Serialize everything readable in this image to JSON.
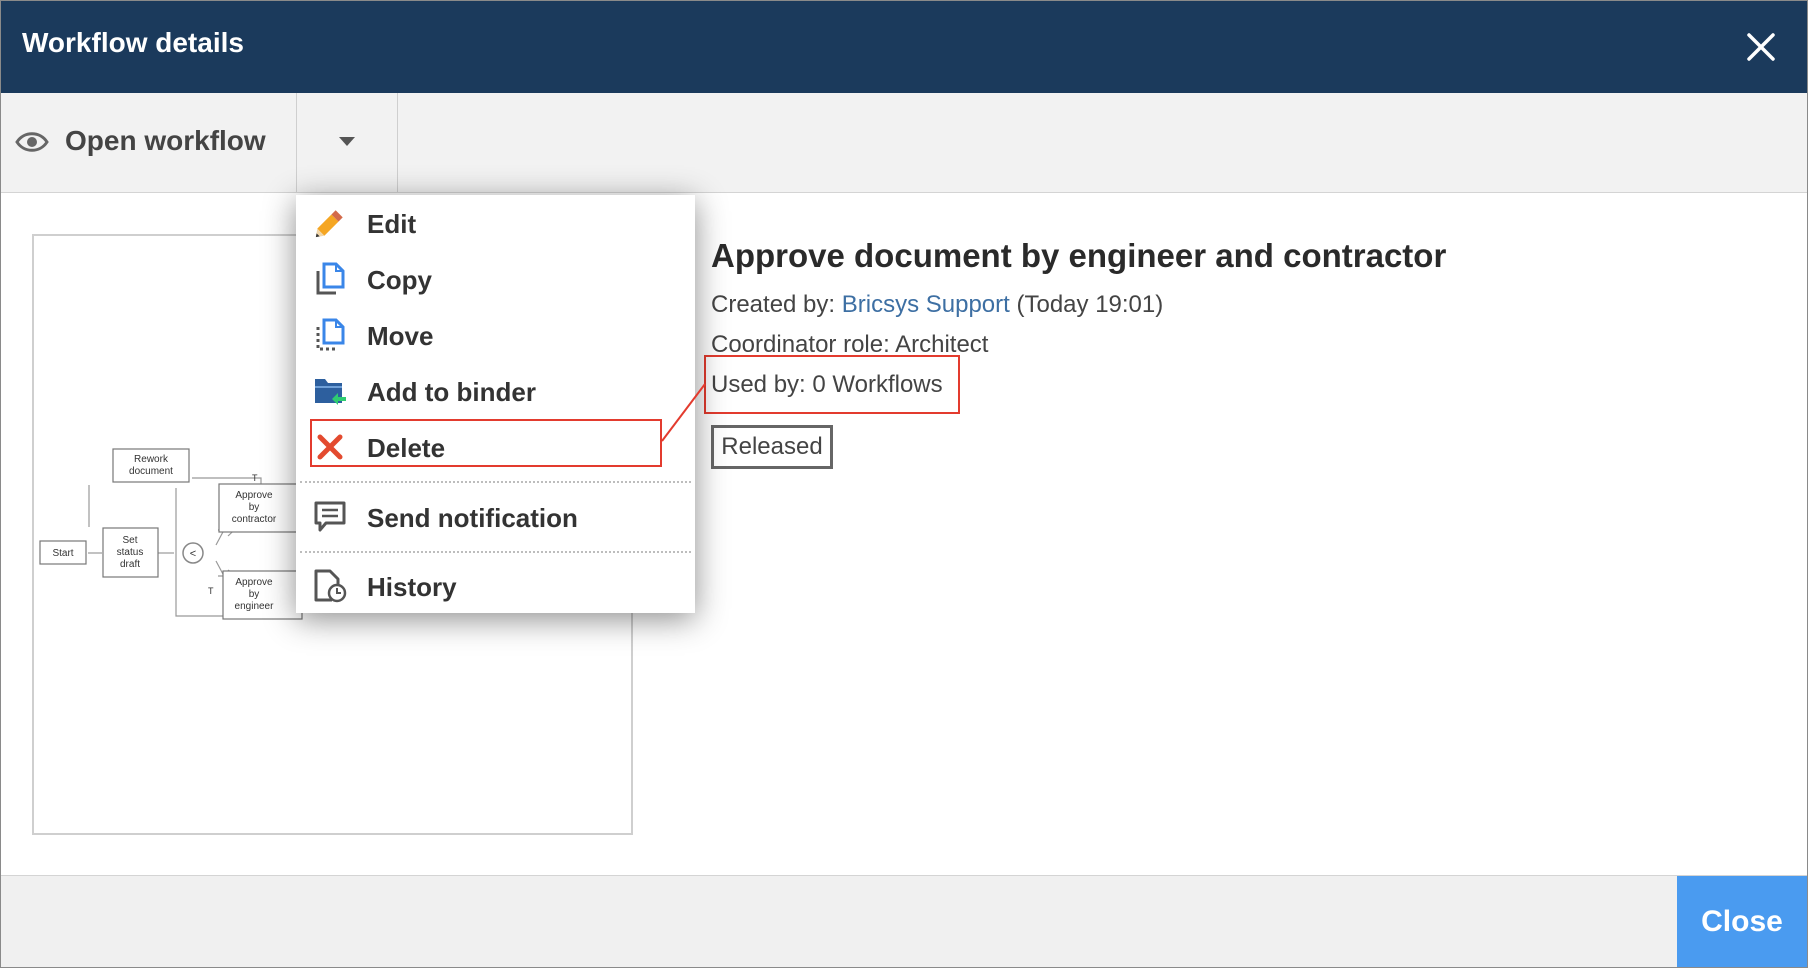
{
  "dialog": {
    "title": "Workflow details"
  },
  "toolbar": {
    "open_label": "Open workflow"
  },
  "menu": {
    "items": [
      {
        "label": "Edit",
        "icon": "pencil-icon"
      },
      {
        "label": "Copy",
        "icon": "copy-icon"
      },
      {
        "label": "Move",
        "icon": "move-icon"
      },
      {
        "label": "Add to binder",
        "icon": "add-to-binder-icon"
      },
      {
        "label": "Delete",
        "icon": "delete-x-icon"
      },
      {
        "label": "Send notification",
        "icon": "notification-icon"
      },
      {
        "label": "History",
        "icon": "history-icon"
      }
    ]
  },
  "diagram": {
    "nodes": {
      "rework": [
        "Rework",
        "document"
      ],
      "start": "Start",
      "set_status": [
        "Set",
        "status",
        "draft"
      ],
      "approve_contractor": [
        "Approve",
        "by",
        "contractor"
      ],
      "approve_engineer": [
        "Approve",
        "by",
        "engineer"
      ],
      "gateway": "<"
    },
    "edge_label": "T"
  },
  "workflow": {
    "name": "Approve document by engineer and contractor",
    "created_label": "Created by:",
    "created_by": "Bricsys Support",
    "created_time": "(Today 19:01)",
    "coordinator": "Coordinator role: Architect",
    "used_by": "Used by: 0 Workflows",
    "status": "Released"
  },
  "footer": {
    "close_label": "Close"
  },
  "colors": {
    "header": "#1b3a5c",
    "link": "#3d6fa3",
    "close_button": "#4a9bf0",
    "highlight": "#e33b2e"
  }
}
